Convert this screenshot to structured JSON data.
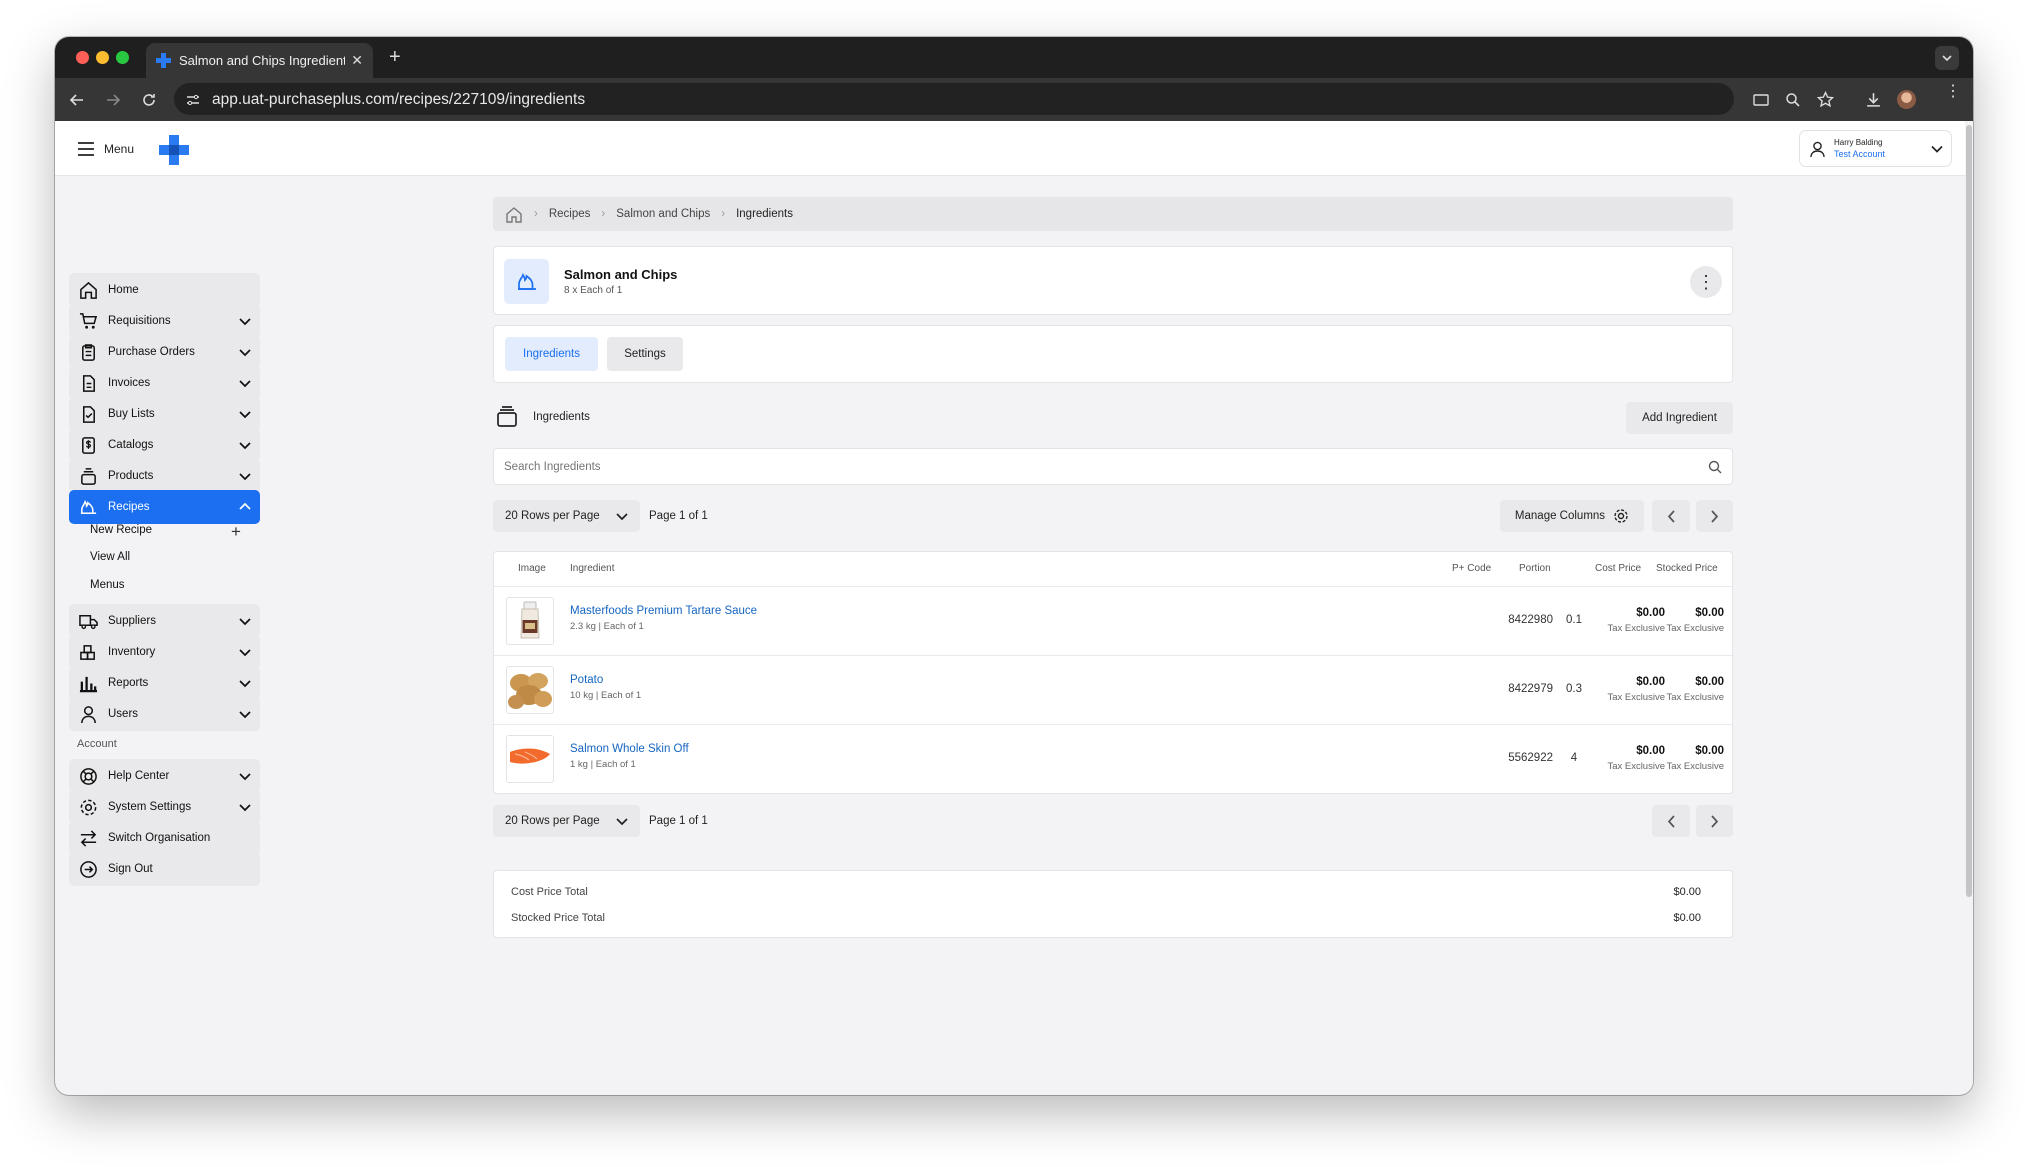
{
  "browser": {
    "tab_title": "Salmon and Chips Ingredients",
    "url": "app.uat-purchaseplus.com/recipes/227109/ingredients"
  },
  "topbar": {
    "menu_label": "Menu",
    "user_name": "Harry Balding",
    "account_name": "Test Account"
  },
  "sidebar": {
    "items": [
      {
        "label": "Home",
        "icon": "home-icon"
      },
      {
        "label": "Requisitions",
        "icon": "cart-icon"
      },
      {
        "label": "Purchase Orders",
        "icon": "clipboard-icon"
      },
      {
        "label": "Invoices",
        "icon": "document-icon"
      },
      {
        "label": "Buy Lists",
        "icon": "checklist-icon"
      },
      {
        "label": "Catalogs",
        "icon": "dollar-doc-icon"
      },
      {
        "label": "Products",
        "icon": "stack-icon"
      },
      {
        "label": "Recipes",
        "icon": "flame-icon",
        "active": true
      }
    ],
    "recipe_sub": [
      "New Recipe",
      "View All",
      "Menus"
    ],
    "items2": [
      {
        "label": "Suppliers",
        "icon": "truck-icon"
      },
      {
        "label": "Inventory",
        "icon": "boxes-icon"
      },
      {
        "label": "Reports",
        "icon": "bar-chart-icon"
      },
      {
        "label": "Users",
        "icon": "user-icon"
      }
    ],
    "account_heading": "Account",
    "account_items": [
      {
        "label": "Help Center",
        "icon": "lifebuoy-icon"
      },
      {
        "label": "System Settings",
        "icon": "gear-icon"
      },
      {
        "label": "Switch Organisation",
        "icon": "swap-icon"
      },
      {
        "label": "Sign Out",
        "icon": "sign-out-icon"
      }
    ]
  },
  "breadcrumb": [
    "Recipes",
    "Salmon and Chips",
    "Ingredients"
  ],
  "recipe": {
    "title": "Salmon and Chips",
    "subtitle": "8 x Each of 1"
  },
  "tabs": [
    "Ingredients",
    "Settings"
  ],
  "ingredients_section": {
    "heading": "Ingredients",
    "add_button": "Add Ingredient",
    "search_placeholder": "Search Ingredients",
    "rows_per_page": "20 Rows per Page",
    "page_info": "Page 1 of 1",
    "manage_columns": "Manage Columns"
  },
  "table": {
    "headers": [
      "Image",
      "Ingredient",
      "P+ Code",
      "Portion",
      "Cost Price",
      "Stocked Price"
    ],
    "rows": [
      {
        "name": "Masterfoods Premium Tartare Sauce",
        "detail": "2.3 kg | Each of 1",
        "code": "8422980",
        "portion": "0.1",
        "cost": "$0.00",
        "cost_tax": "Tax Exclusive",
        "stocked": "$0.00",
        "stocked_tax": "Tax Exclusive",
        "image": "sauce-jar"
      },
      {
        "name": "Potato",
        "detail": "10 kg | Each of 1",
        "code": "8422979",
        "portion": "0.3",
        "cost": "$0.00",
        "cost_tax": "Tax Exclusive",
        "stocked": "$0.00",
        "stocked_tax": "Tax Exclusive",
        "image": "potatoes"
      },
      {
        "name": "Salmon Whole Skin Off",
        "detail": "1 kg | Each of 1",
        "code": "5562922",
        "portion": "4",
        "cost": "$0.00",
        "cost_tax": "Tax Exclusive",
        "stocked": "$0.00",
        "stocked_tax": "Tax Exclusive",
        "image": "salmon-fillet"
      }
    ]
  },
  "totals": {
    "cost_label": "Cost Price Total",
    "cost_value": "$0.00",
    "stocked_label": "Stocked Price Total",
    "stocked_value": "$0.00"
  },
  "colors": {
    "accent": "#1b6ff0",
    "link": "#1565c0"
  }
}
